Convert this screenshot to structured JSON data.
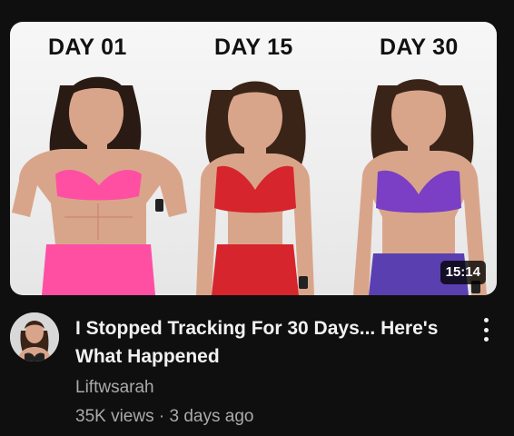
{
  "video": {
    "thumbnail": {
      "labels": [
        "DAY 01",
        "DAY 15",
        "DAY 30"
      ],
      "duration": "15:14"
    },
    "title": "I Stopped Tracking For 30 Days... Here's What Happened",
    "channel": "Liftwsarah",
    "views": "35K views",
    "separator": "·",
    "age": "3 days ago"
  },
  "colors": {
    "background": "#0f0f0f",
    "title_text": "#f1f1f1",
    "secondary_text": "#aaaaaa",
    "pink_outfit": "#ff4fa3",
    "red_outfit": "#d6252c",
    "purple_outfit": "#7a3fc4"
  },
  "icons": {
    "menu": "more-vert-icon"
  }
}
